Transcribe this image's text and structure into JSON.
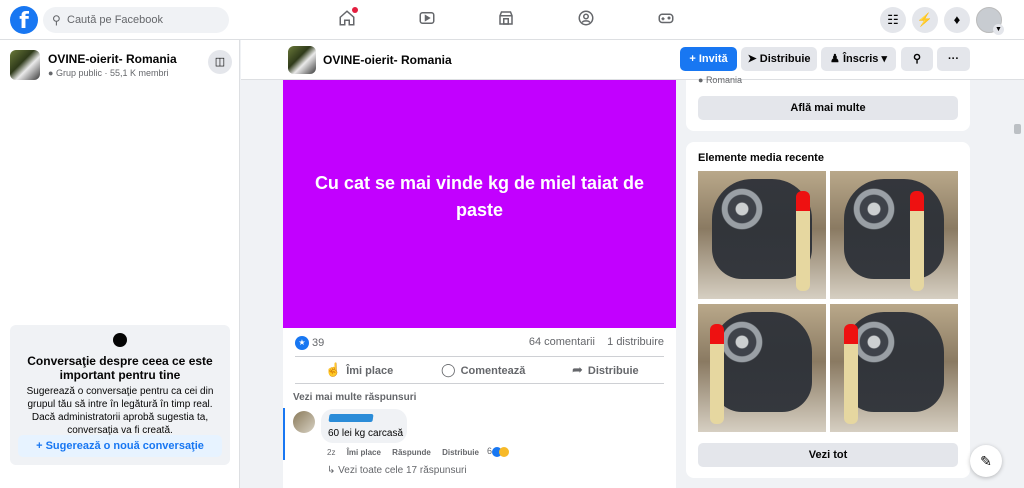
{
  "topbar": {
    "search_placeholder": "Caută pe Facebook",
    "nav_icons": [
      "home-icon",
      "watch-icon",
      "marketplace-icon",
      "groups-icon",
      "gaming-icon"
    ],
    "right_icons": [
      "menu-icon",
      "messenger-icon",
      "notifications-icon",
      "profile-avatar"
    ]
  },
  "sidebar": {
    "group_name": "OVINE-oierit- Romania",
    "group_meta": "Grup public · 55,1 K membri",
    "conversation": {
      "title": "Conversaţie despre ceea ce este important pentru tine",
      "description": "Sugerează o conversaţie pentru ca cei din grupul tău să intre în legătură în timp real. Dacă administratorii aprobă sugestia ta, conversaţia va fi creată.",
      "button": "Sugerează o nouă conversaţie"
    }
  },
  "group_header": {
    "name": "OVINE-oierit- Romania",
    "invite": "Invită",
    "share": "Distribuie",
    "joined": "Înscris"
  },
  "post": {
    "text": "Cu cat se mai vinde kg de miel taiat de paste",
    "reactions": "39",
    "comments": "64 comentarii",
    "shares": "1 distribuire",
    "like": "Îmi place",
    "comment": "Comentează",
    "share": "Distribuie",
    "more_replies": "Vezi mai multe răspunsuri",
    "reply": {
      "text": "60 lei kg carcasă",
      "time": "2z",
      "like": "Îmi place",
      "respond": "Răspunde",
      "share": "Distribuie",
      "reaction_count": "6"
    },
    "view_all": "Vezi toate cele 17 răspunsuri"
  },
  "about": {
    "location_cut": "Romania",
    "learn_more": "Află mai multe"
  },
  "media": {
    "title": "Elemente media recente",
    "see_all": "Vezi tot"
  },
  "colors": {
    "brand": "#1877f2",
    "post_background": "#c200ff"
  }
}
